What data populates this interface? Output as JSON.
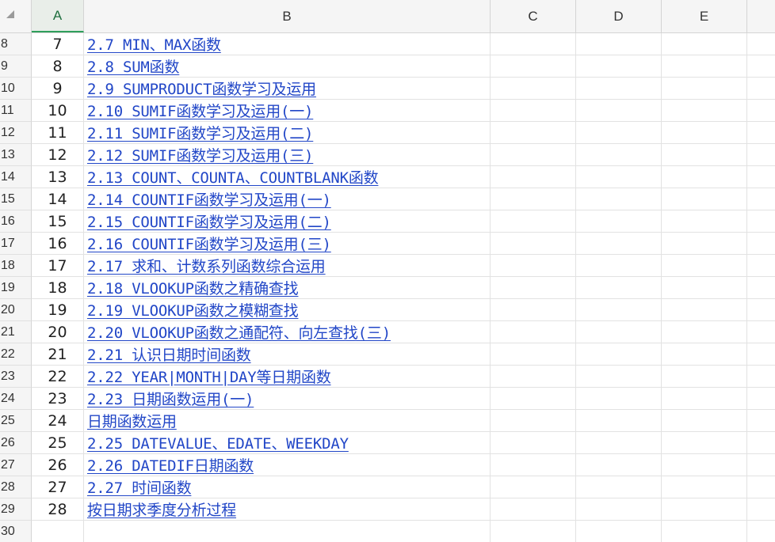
{
  "columns": [
    "A",
    "B",
    "C",
    "D",
    "E"
  ],
  "rows": [
    {
      "row": "8",
      "a": "7",
      "b": "2.7 MIN、MAX函数"
    },
    {
      "row": "9",
      "a": "8",
      "b": "2.8 SUM函数"
    },
    {
      "row": "10",
      "a": "9",
      "b": "2.9 SUMPRODUCT函数学习及运用"
    },
    {
      "row": "11",
      "a": "10",
      "b": "2.10 SUMIF函数学习及运用(一)"
    },
    {
      "row": "12",
      "a": "11",
      "b": "2.11 SUMIF函数学习及运用(二)"
    },
    {
      "row": "13",
      "a": "12",
      "b": "2.12 SUMIF函数学习及运用(三)"
    },
    {
      "row": "14",
      "a": "13",
      "b": "2.13 COUNT、COUNTA、COUNTBLANK函数"
    },
    {
      "row": "15",
      "a": "14",
      "b": "2.14 COUNTIF函数学习及运用(一)"
    },
    {
      "row": "16",
      "a": "15",
      "b": "2.15 COUNTIF函数学习及运用(二)"
    },
    {
      "row": "17",
      "a": "16",
      "b": "2.16 COUNTIF函数学习及运用(三)"
    },
    {
      "row": "18",
      "a": "17",
      "b": "2.17 求和、计数系列函数综合运用"
    },
    {
      "row": "19",
      "a": "18",
      "b": "2.18 VLOOKUP函数之精确查找"
    },
    {
      "row": "20",
      "a": "19",
      "b": "2.19 VLOOKUP函数之模糊查找"
    },
    {
      "row": "21",
      "a": "20",
      "b": "2.20 VLOOKUP函数之通配符、向左查找(三)"
    },
    {
      "row": "22",
      "a": "21",
      "b": "2.21 认识日期时间函数"
    },
    {
      "row": "23",
      "a": "22",
      "b": "2.22 YEAR|MONTH|DAY等日期函数"
    },
    {
      "row": "24",
      "a": "23",
      "b": "2.23 日期函数运用(一)"
    },
    {
      "row": "25",
      "a": "24",
      "b": "日期函数运用"
    },
    {
      "row": "26",
      "a": "25",
      "b": "2.25 DATEVALUE、EDATE、WEEKDAY"
    },
    {
      "row": "27",
      "a": "26",
      "b": "2.26 DATEDIF日期函数"
    },
    {
      "row": "28",
      "a": "27",
      "b": "2.27 时间函数"
    },
    {
      "row": "29",
      "a": "28",
      "b": "按日期求季度分析过程"
    },
    {
      "row": "30",
      "a": "",
      "b": ""
    }
  ]
}
